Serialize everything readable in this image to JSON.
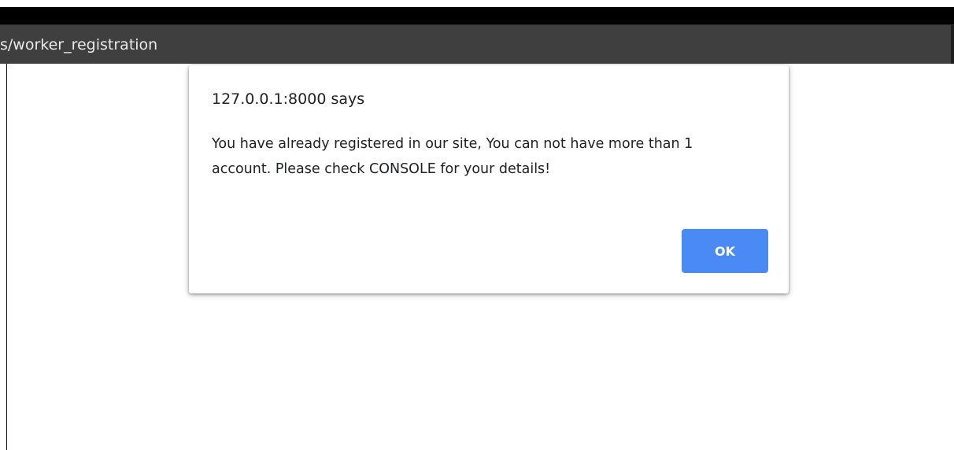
{
  "browser": {
    "url_fragment": "s/worker_registration"
  },
  "dialog": {
    "title": "127.0.0.1:8000 says",
    "message": "You have already registered in our site, You can not have more than 1 account. Please check CONSOLE for your details!",
    "ok_label": "OK",
    "ok_color": "#4a8af4"
  }
}
